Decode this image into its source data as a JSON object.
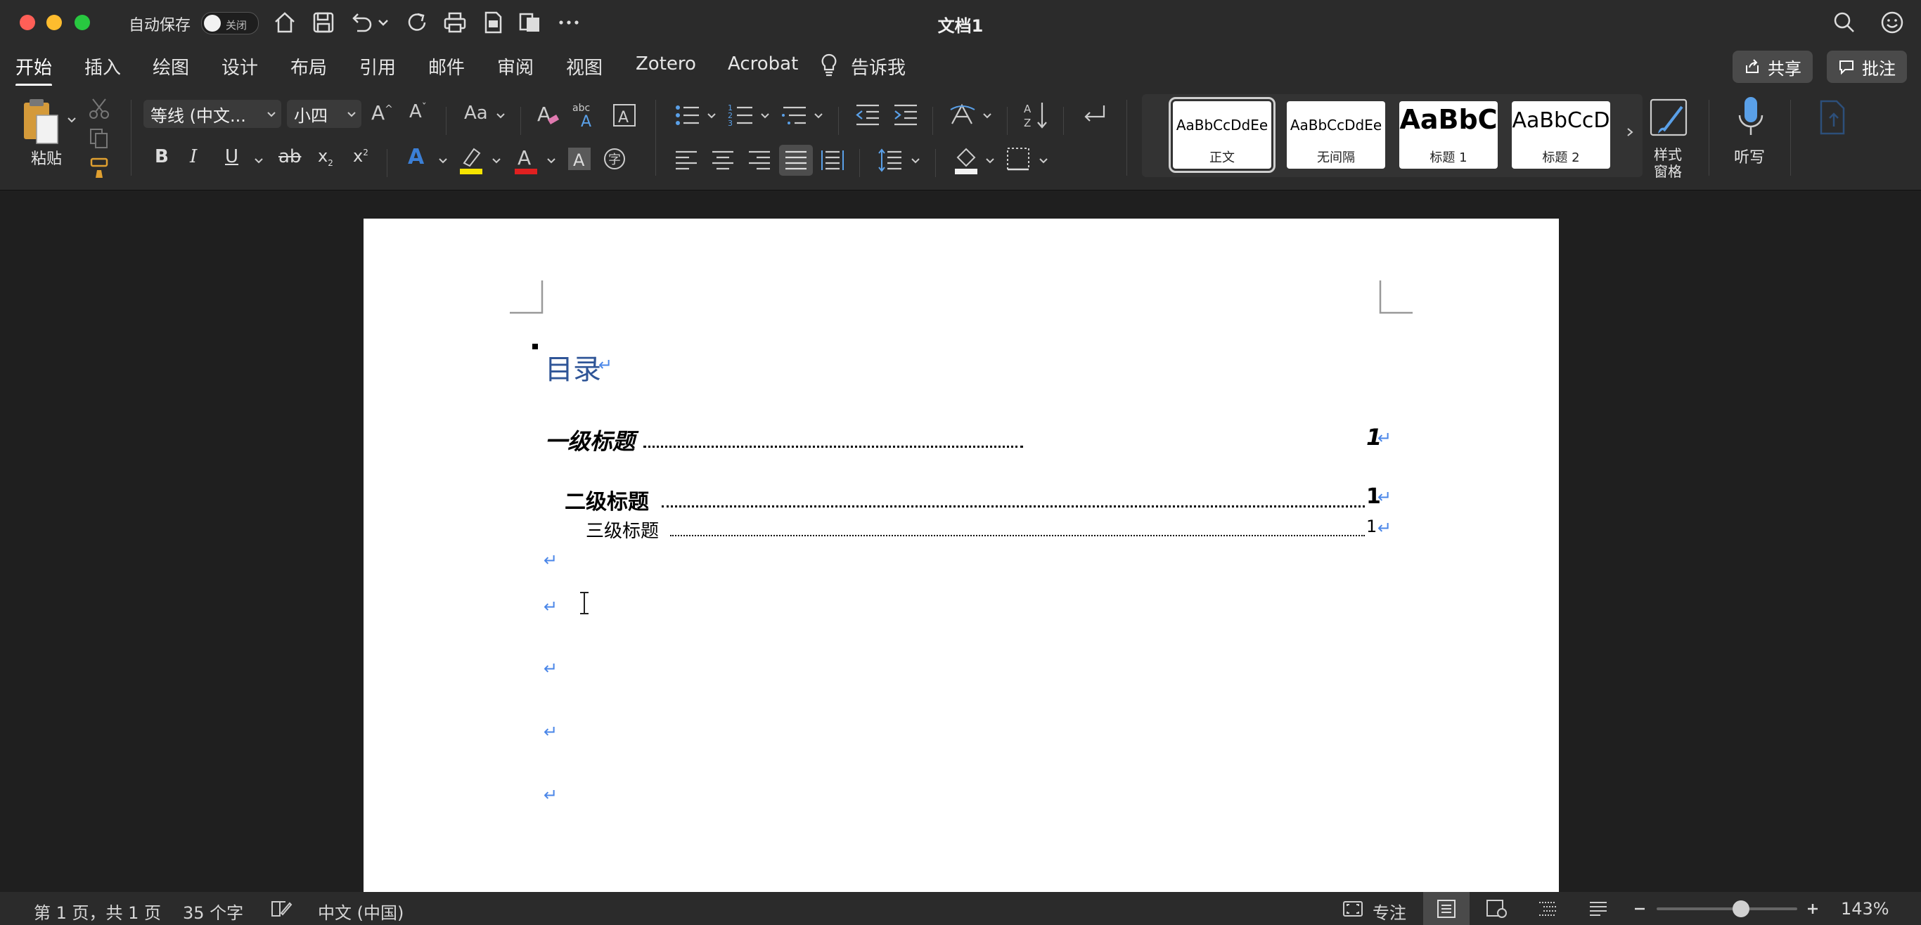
{
  "titlebar": {
    "autosave_label": "自动保存",
    "autosave_state": "关闭",
    "doc_title": "文档1"
  },
  "tabs": [
    {
      "label": "开始",
      "active": true
    },
    {
      "label": "插入"
    },
    {
      "label": "绘图"
    },
    {
      "label": "设计"
    },
    {
      "label": "布局"
    },
    {
      "label": "引用"
    },
    {
      "label": "邮件"
    },
    {
      "label": "审阅"
    },
    {
      "label": "视图"
    },
    {
      "label": "Zotero"
    },
    {
      "label": "Acrobat"
    }
  ],
  "tell_me": "告诉我",
  "share_label": "共享",
  "comments_label": "批注",
  "ribbon": {
    "paste_label": "粘贴",
    "font_name": "等线 (中文...",
    "font_size": "小四",
    "change_case": "Aa",
    "styles": [
      {
        "sample": "AaBbCcDdEe",
        "name": "正文",
        "selected": true
      },
      {
        "sample": "AaBbCcDdEe",
        "name": "无间隔"
      },
      {
        "sample": "AaBbC",
        "name": "标题 1"
      },
      {
        "sample": "AaBbCcD",
        "name": "标题 2"
      }
    ],
    "styles_pane_label": "样式\n窗格",
    "dictate_label": "听写"
  },
  "document": {
    "toc_title": "目录",
    "entries": [
      {
        "text": "一级标题",
        "page": "1",
        "level": 1
      },
      {
        "text": "二级标题",
        "page": "1",
        "level": 2
      },
      {
        "text": "三级标题",
        "page": "1",
        "level": 3
      }
    ],
    "para_mark": "↵"
  },
  "statusbar": {
    "page_info": "第 1 页，共 1 页",
    "word_count": "35 个字",
    "language": "中文 (中国)",
    "focus_label": "专注",
    "zoom": "143%",
    "zoom_level": 0.6
  },
  "colors": {
    "chrome_bg": "#2b2b2b",
    "canvas_bg": "#1f1f1f",
    "heading_blue": "#2f5597",
    "para_mark_blue": "#4a86e8"
  }
}
